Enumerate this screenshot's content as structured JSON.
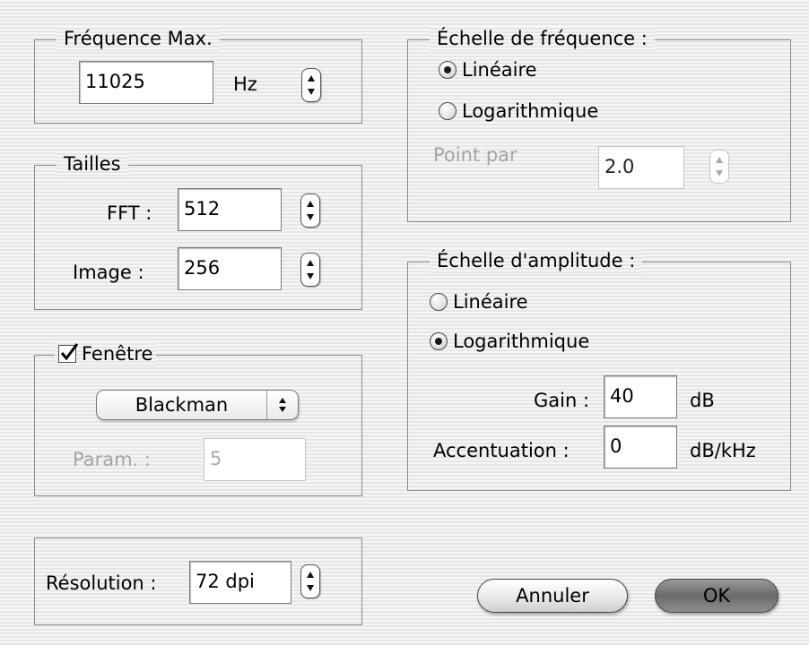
{
  "freq_max": {
    "title": "Fréquence Max.",
    "value": "11025",
    "unit": "Hz"
  },
  "sizes": {
    "title": "Tailles",
    "fft_label": "FFT :",
    "fft_value": "512",
    "image_label": "Image :",
    "image_value": "256"
  },
  "window": {
    "title": "Fenêtre",
    "checked": true,
    "type_selected": "Blackman",
    "param_label": "Param. :",
    "param_value": "5"
  },
  "resolution": {
    "label": "Résolution :",
    "value": "72 dpi"
  },
  "freq_scale": {
    "title": "Échelle de fréquence :",
    "options": [
      "Linéaire",
      "Logarithmique"
    ],
    "selected": "Linéaire",
    "points_label": "Point par",
    "points_value": "2.0"
  },
  "amp_scale": {
    "title": "Échelle d'amplitude :",
    "options": [
      "Linéaire",
      "Logarithmique"
    ],
    "selected": "Logarithmique",
    "gain_label": "Gain :",
    "gain_value": "40",
    "gain_unit": "dB",
    "accent_label": "Accentuation :",
    "accent_value": "0",
    "accent_unit": "dB/kHz"
  },
  "buttons": {
    "cancel": "Annuler",
    "ok": "OK"
  },
  "icons": {
    "stepper": "up-down-arrows-icon",
    "popup": "up-down-chevron-icon",
    "checkbox": "checkmark-icon"
  }
}
